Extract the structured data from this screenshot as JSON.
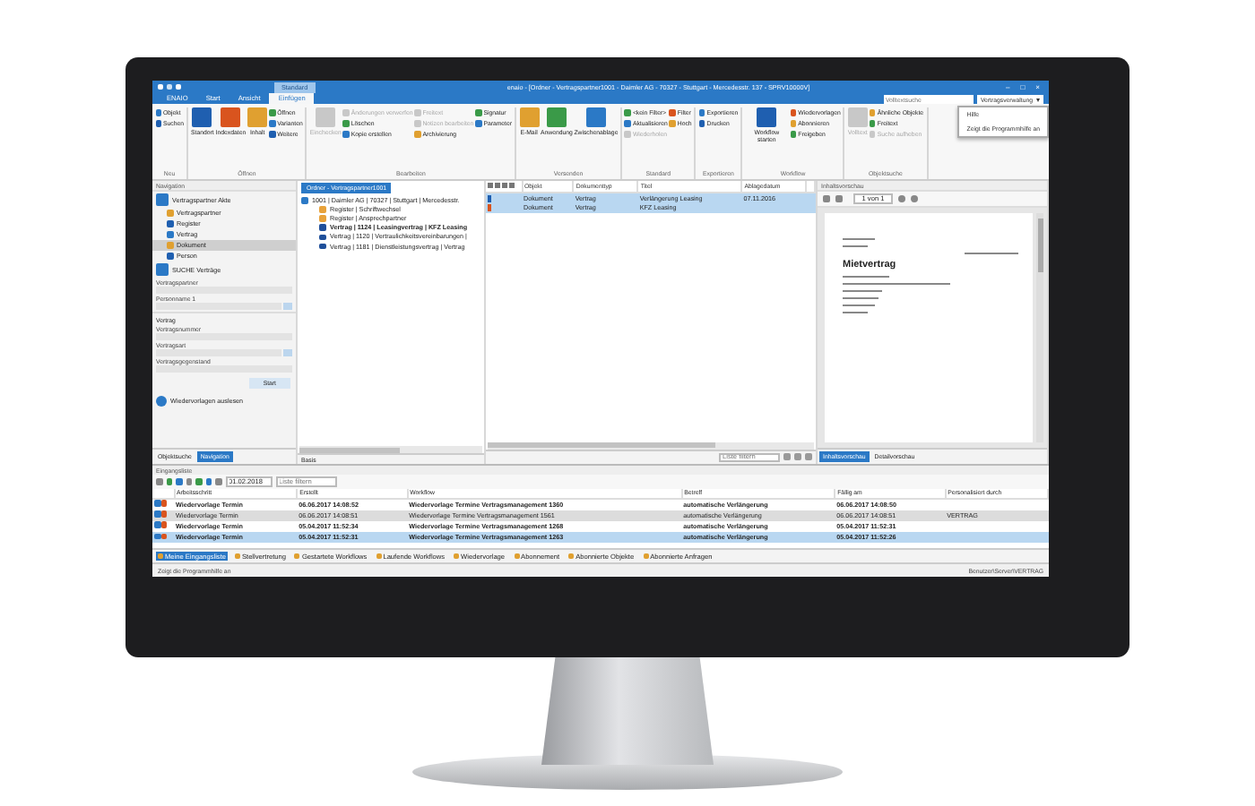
{
  "titlebar": {
    "title": "enaio - [Ordner - Vertragspartner1001 - Daimler AG - 70327 - Stuttgart - Mercedesstr. 137 - SPRV10000V]",
    "context_tab": "Standard",
    "window_controls": [
      "–",
      "□",
      "×"
    ],
    "tabs": [
      {
        "label": "ENAIO",
        "selected": false
      },
      {
        "label": "Start",
        "selected": false
      },
      {
        "label": "Ansicht",
        "selected": false
      },
      {
        "label": "Einfügen",
        "selected": true
      }
    ],
    "search": {
      "placeholder": "Volltextsuche"
    },
    "scope": "Vertragsverwaltung",
    "help_menu": [
      "Hilfe",
      "Zeigt die Programmhilfe an"
    ]
  },
  "ribbon": [
    {
      "name": "Neu",
      "buttons": [
        {
          "label": "Objekt",
          "kind": "small",
          "disabled": false
        },
        {
          "label": "Suchen",
          "kind": "small",
          "disabled": false
        }
      ]
    },
    {
      "name": "Öffnen",
      "buttons": [
        {
          "label": "Standort",
          "kind": "large",
          "disabled": false
        },
        {
          "label": "Indexdaten",
          "kind": "large",
          "disabled": false
        },
        {
          "label": "Inhalt",
          "kind": "large",
          "disabled": false
        },
        {
          "label": "Öffnen",
          "kind": "small",
          "disabled": false
        },
        {
          "label": "Varianten",
          "kind": "small",
          "disabled": false
        },
        {
          "label": "Weitere",
          "kind": "small",
          "disabled": false
        }
      ]
    },
    {
      "name": "Bearbeiten",
      "buttons": [
        {
          "label": "Einchecken",
          "kind": "large",
          "disabled": true
        },
        {
          "label": "Änderungen verwerfen",
          "kind": "small",
          "disabled": true
        },
        {
          "label": "Löschen",
          "kind": "small",
          "disabled": false
        },
        {
          "label": "Kopie erstellen",
          "kind": "small",
          "disabled": false
        },
        {
          "label": "Freitext",
          "kind": "small",
          "disabled": true
        },
        {
          "label": "Notizen bearbeiten",
          "kind": "small",
          "disabled": true
        },
        {
          "label": "Archivierung",
          "kind": "small",
          "disabled": false
        },
        {
          "label": "Signatur",
          "kind": "small",
          "disabled": false
        },
        {
          "label": "Parameter",
          "kind": "small",
          "disabled": false
        }
      ]
    },
    {
      "name": "Versenden",
      "buttons": [
        {
          "label": "E-Mail",
          "kind": "large",
          "disabled": false
        },
        {
          "label": "Anwendung",
          "kind": "large",
          "disabled": false
        },
        {
          "label": "Zwischenablage",
          "kind": "large",
          "disabled": false
        }
      ]
    },
    {
      "name": "Standard",
      "buttons": [
        {
          "label": "<kein Filter>",
          "kind": "small",
          "disabled": false
        },
        {
          "label": "Aktualisieren",
          "kind": "small",
          "disabled": false
        },
        {
          "label": "Wiederholen",
          "kind": "small",
          "disabled": true
        },
        {
          "label": "Filter",
          "kind": "small",
          "disabled": false
        },
        {
          "label": "Hoch",
          "kind": "small",
          "disabled": false
        }
      ]
    },
    {
      "name": "Exportieren",
      "buttons": [
        {
          "label": "Exportieren",
          "kind": "small",
          "disabled": false
        },
        {
          "label": "Drucken",
          "kind": "small",
          "disabled": false
        }
      ]
    },
    {
      "name": "Workflow",
      "buttons": [
        {
          "label": "Workflow starten",
          "kind": "large",
          "disabled": false
        },
        {
          "label": "Wiedervorlagen",
          "kind": "small",
          "disabled": false
        },
        {
          "label": "Abonnieren",
          "kind": "small",
          "disabled": false
        },
        {
          "label": "Freigeben",
          "kind": "small",
          "disabled": false
        }
      ]
    },
    {
      "name": "Objektsuche",
      "buttons": [
        {
          "label": "Volltext",
          "kind": "large",
          "disabled": true
        },
        {
          "label": "Ähnliche Objekte",
          "kind": "small",
          "disabled": false
        },
        {
          "label": "Freitext",
          "kind": "small",
          "disabled": false
        },
        {
          "label": "Suche aufheben",
          "kind": "small",
          "disabled": true
        }
      ]
    }
  ],
  "navigation": {
    "title": "Navigation",
    "items": [
      {
        "label": "Vertragspartner Akte",
        "selected": false,
        "children": [
          {
            "label": "Vertragspartner",
            "selected": false
          },
          {
            "label": "Register",
            "selected": false
          },
          {
            "label": "Vertrag",
            "selected": false
          },
          {
            "label": "Dokument",
            "selected": true
          },
          {
            "label": "Person",
            "selected": false
          }
        ]
      },
      {
        "label": "SUCHE Verträge",
        "selected": false
      }
    ],
    "fields": [
      {
        "label": "Vertragspartner",
        "kind": "field"
      },
      {
        "label": "Personname 1",
        "kind": "lookup"
      },
      {
        "label": "Vertrag",
        "kind": "section"
      },
      {
        "label": "Vertragsnummer",
        "kind": "field"
      },
      {
        "label": "Vertragsart",
        "kind": "lookup"
      },
      {
        "label": "Vertragsgegenstand",
        "kind": "field"
      }
    ],
    "start_button": "Start",
    "resubmission": "Wiedervorlagen auslesen",
    "tabs": [
      {
        "label": "Objektsuche",
        "selected": false
      },
      {
        "label": "Navigation",
        "selected": true
      }
    ]
  },
  "tree": {
    "tab": "Ordner - Vertragspartner1001",
    "root": "1001 | Daimler AG | 70327 | Stuttgart | Mercedesstr.",
    "children": [
      {
        "label": "Register | Schriftwechsel",
        "kind": "folder",
        "bold": false
      },
      {
        "label": "Register | Ansprechpartner",
        "kind": "folder",
        "bold": false
      },
      {
        "label": "Vertrag | 1124 | Leasingvertrag | KFZ Leasing",
        "kind": "contract",
        "bold": true
      },
      {
        "label": "Vertrag | 1120 | Vertraulichkeitsvereinbarungen |",
        "kind": "contract",
        "bold": false
      },
      {
        "label": "Vertrag | 1181 | Dienstleistungsvertrag | Vertrag",
        "kind": "contract",
        "bold": false
      }
    ],
    "footer": "Basis"
  },
  "list": {
    "columns": [
      "Objekt",
      "Dokumenttyp",
      "Titel",
      "Ablagedatum"
    ],
    "rows": [
      {
        "cells": [
          "Dokument",
          "Vertrag",
          "Verlängerung Leasing",
          "07.11.2016"
        ],
        "selected": true,
        "color": "#1f5fb0"
      },
      {
        "cells": [
          "Dokument",
          "Vertrag",
          "KFZ Leasing",
          ""
        ],
        "selected": true,
        "color": "#d9541e"
      }
    ],
    "filter": {
      "placeholder": "Liste filtern"
    }
  },
  "preview": {
    "title": "Inhaltsvorschau",
    "page": "1 von 1",
    "heading": "Mietvertrag",
    "tabs": [
      {
        "label": "Inhaltsvorschau",
        "selected": true
      },
      {
        "label": "Detailvorschau",
        "selected": false
      }
    ]
  },
  "inbox": {
    "title": "Eingangsliste",
    "date": "01.02.2018",
    "filter": {
      "placeholder": "Liste filtern"
    },
    "columns": [
      "Arbeitsschritt",
      "Erstellt",
      "Workflow",
      "Betreff",
      "Fällig am",
      "Personalisiert durch"
    ],
    "rows": [
      {
        "cells": [
          "Wiedervorlage Termin",
          "06.06.2017 14:08:52",
          "Wiedervorlage Termine Vertragsmanagement 1360",
          "automatische Verlängerung",
          "06.06.2017 14:08:50",
          ""
        ],
        "bold": true,
        "selected": false
      },
      {
        "cells": [
          "Wiedervorlage Termin",
          "06.06.2017 14:08:51",
          "Wiedervorlage Termine Vertragsmanagement 1561",
          "automatische Verlängerung",
          "06.06.2017 14:08:51",
          "VERTRAG"
        ],
        "bold": false,
        "selected": false
      },
      {
        "cells": [
          "Wiedervorlage Termin",
          "05.04.2017 11:52:34",
          "Wiedervorlage Termine Vertragsmanagement 1268",
          "automatische Verlängerung",
          "05.04.2017 11:52:31",
          ""
        ],
        "bold": true,
        "selected": false
      },
      {
        "cells": [
          "Wiedervorlage Termin",
          "05.04.2017 11:52:31",
          "Wiedervorlage Termine Vertragsmanagement 1263",
          "automatische Verlängerung",
          "05.04.2017 11:52:26",
          ""
        ],
        "bold": true,
        "selected": true
      }
    ],
    "tabs": [
      {
        "label": "Meine Eingangsliste",
        "selected": true
      },
      {
        "label": "Stellvertretung",
        "selected": false
      },
      {
        "label": "Gestartete Workflows",
        "selected": false
      },
      {
        "label": "Laufende Workflows",
        "selected": false
      },
      {
        "label": "Wiedervorlage",
        "selected": false
      },
      {
        "label": "Abonnement",
        "selected": false
      },
      {
        "label": "Abonnierte Objekte",
        "selected": false
      },
      {
        "label": "Abonnierte Anfragen",
        "selected": false
      }
    ]
  },
  "status_bar": {
    "hint": "Zeigt die Programmhilfe an",
    "user": "Benutzer\\Server\\VERTRAG"
  }
}
